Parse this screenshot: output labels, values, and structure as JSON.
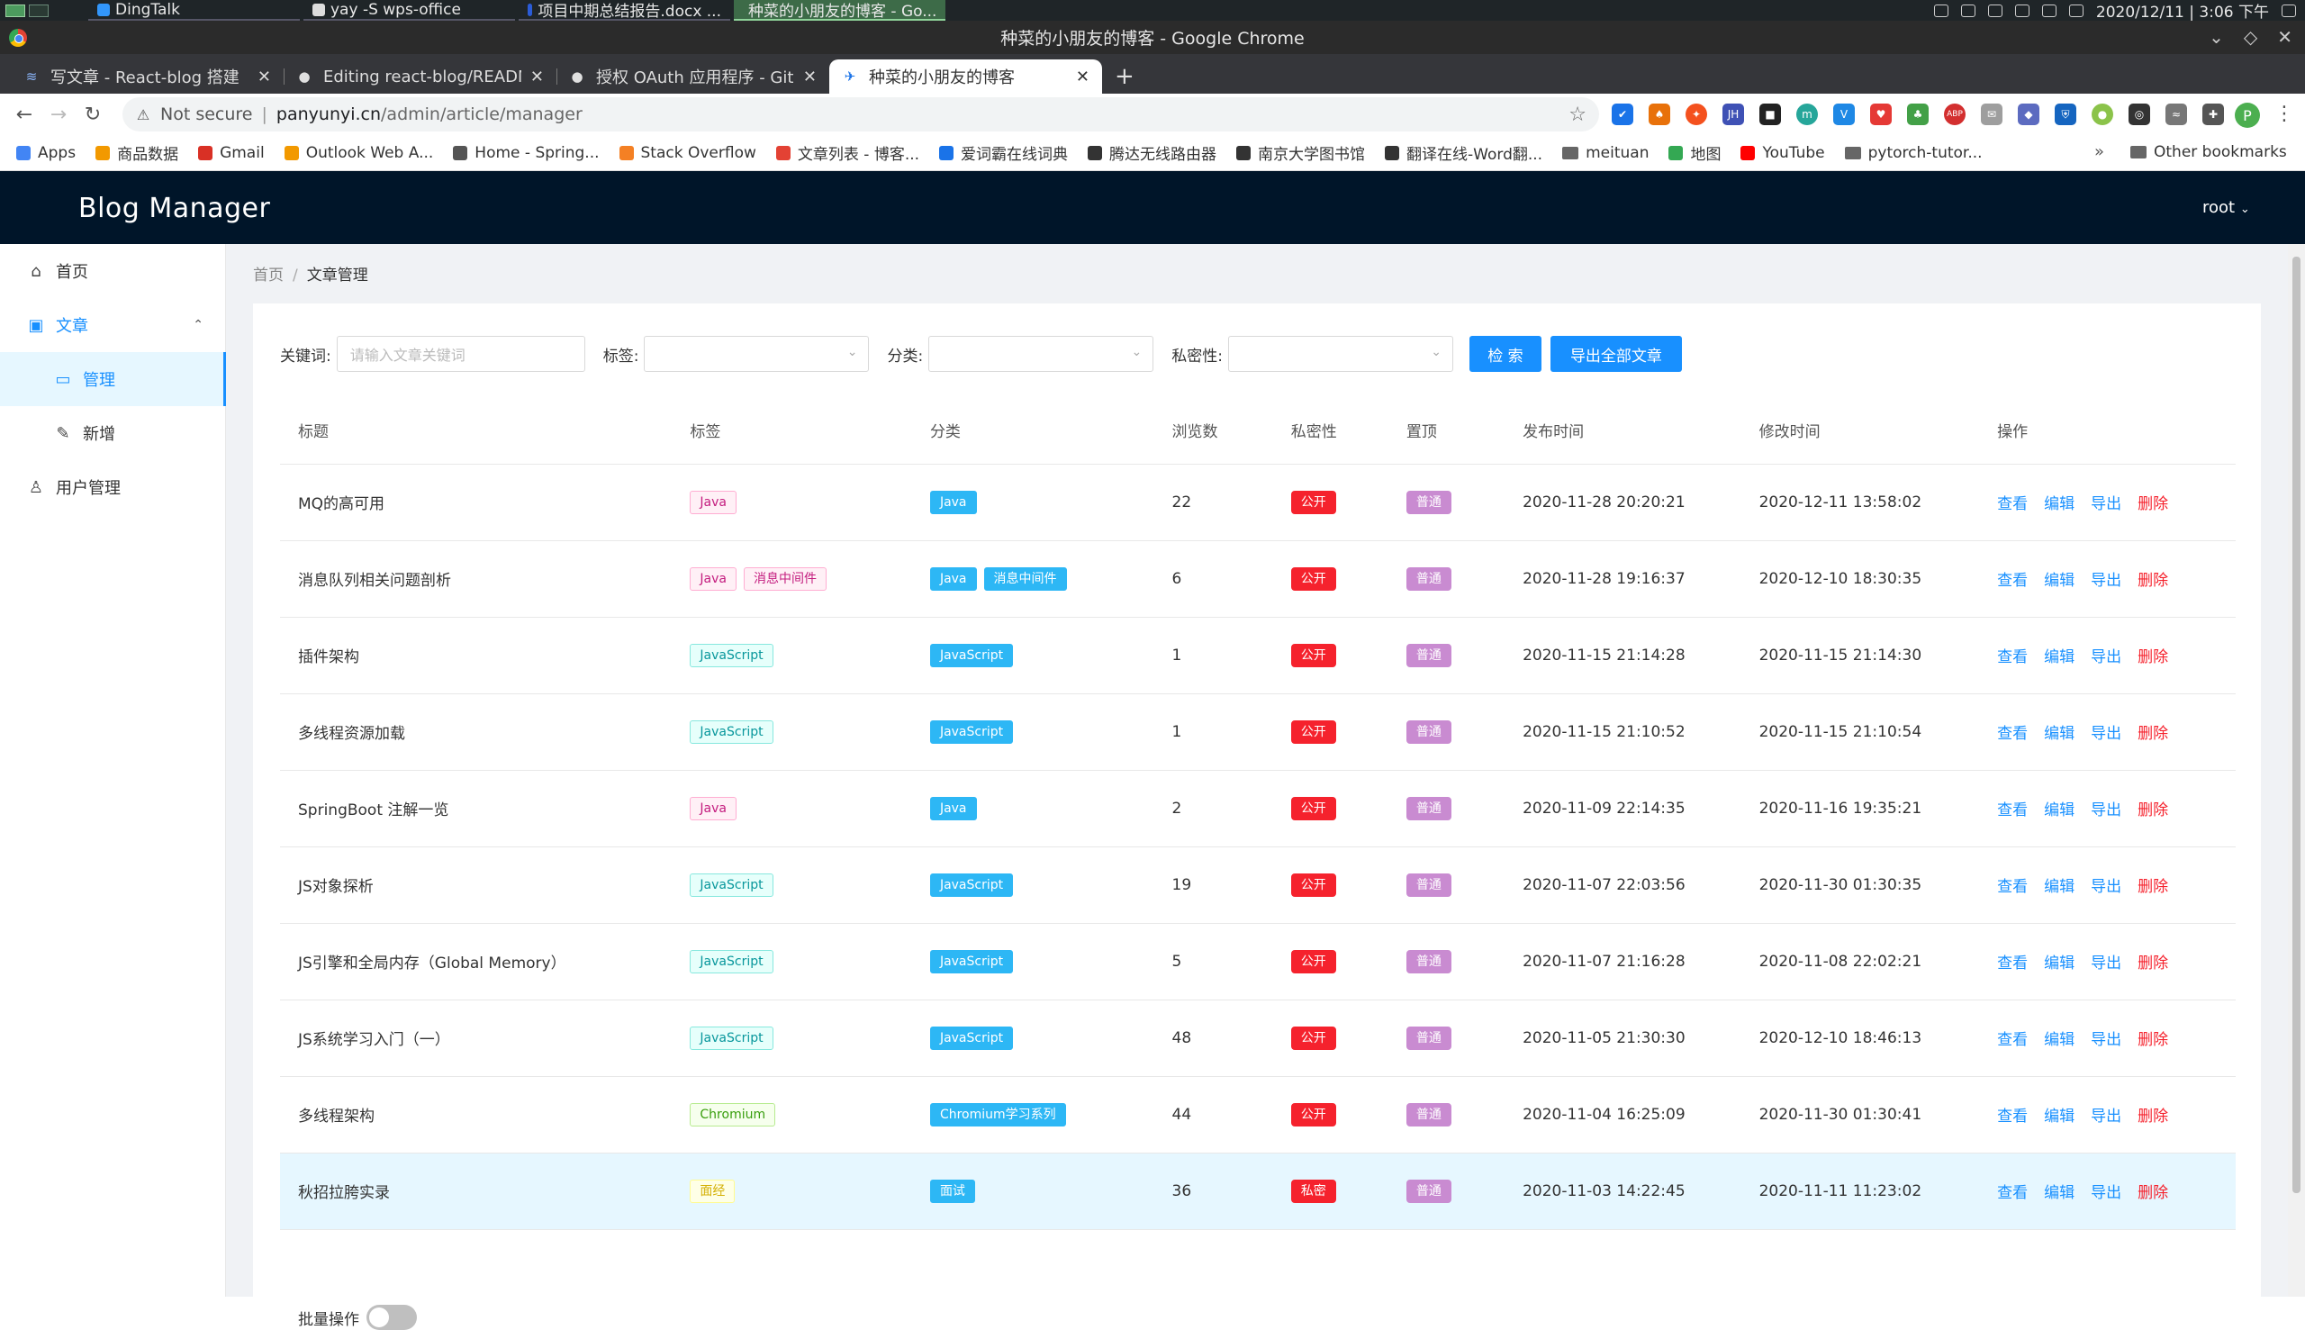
{
  "taskbar": {
    "tasks": [
      {
        "label": "DingTalk",
        "color": "#3296fa",
        "active": false
      },
      {
        "label": "yay -S wps-office",
        "color": "#dddddd",
        "active": false
      },
      {
        "label": "项目中期总结报告.docx ...",
        "color": "#2b5cd7",
        "active": false
      },
      {
        "label": "种菜的小朋友的博客 - Go...",
        "color": "#e34234",
        "active": true
      }
    ],
    "datetime": "2020/12/11 | 3:06 下午"
  },
  "window": {
    "title": "种菜的小朋友的博客 - Google Chrome"
  },
  "tabs": [
    {
      "label": "写文章 - React-blog 搭建",
      "icon": "zhihu-icon"
    },
    {
      "label": "Editing react-blog/README",
      "icon": "github-icon"
    },
    {
      "label": "授权 OAuth 应用程序 - GitHub",
      "icon": "github-icon"
    },
    {
      "label": "种菜的小朋友的博客",
      "icon": "bird-icon"
    }
  ],
  "address": {
    "security": "Not secure",
    "host": "panyunyi.cn",
    "path": "/admin/article/manager"
  },
  "bookmarks": [
    {
      "label": "Apps",
      "color": "#4285f4"
    },
    {
      "label": "商品数据",
      "color": "#f29900"
    },
    {
      "label": "Gmail",
      "color": "#d93025"
    },
    {
      "label": "Outlook Web A...",
      "color": "#f29900"
    },
    {
      "label": "Home - Spring...",
      "color": "#555555"
    },
    {
      "label": "Stack Overflow",
      "color": "#f48024"
    },
    {
      "label": "文章列表 - 博客...",
      "color": "#e34234"
    },
    {
      "label": "爱词霸在线词典",
      "color": "#1a73e8"
    },
    {
      "label": "腾达无线路由器",
      "color": "#333333"
    },
    {
      "label": "南京大学图书馆",
      "color": "#333333"
    },
    {
      "label": "翻译在线-Word翻...",
      "color": "#333333"
    },
    {
      "label": "meituan",
      "color": "#666666"
    },
    {
      "label": "地图",
      "color": "#34a853"
    },
    {
      "label": "YouTube",
      "color": "#ff0000"
    },
    {
      "label": "pytorch-tutor...",
      "color": "#666666"
    }
  ],
  "bookmarks_more": "»",
  "bookmarks_other": "Other bookmarks",
  "app": {
    "brand": "Blog Manager",
    "user": "root"
  },
  "sidebar": {
    "home": "首页",
    "article": "文章",
    "manage": "管理",
    "add": "新增",
    "users": "用户管理"
  },
  "breadcrumb": {
    "home": "首页",
    "current": "文章管理"
  },
  "filters": {
    "keyword_label": "关键词:",
    "keyword_placeholder": "请输入文章关键词",
    "tag_label": "标签:",
    "category_label": "分类:",
    "privacy_label": "私密性:",
    "search_button": "检 索",
    "export_all_button": "导出全部文章"
  },
  "table": {
    "headers": [
      "标题",
      "标签",
      "分类",
      "浏览数",
      "私密性",
      "置顶",
      "发布时间",
      "修改时间",
      "操作"
    ],
    "actions": {
      "view": "查看",
      "edit": "编辑",
      "export": "导出",
      "delete": "删除"
    },
    "rows": [
      {
        "title": "MQ的高可用",
        "tags": [
          {
            "t": "Java",
            "c": "java"
          }
        ],
        "cats": [
          "Java"
        ],
        "views": "22",
        "privacy": "公开",
        "pin": "普通",
        "published": "2020-11-28 20:20:21",
        "modified": "2020-12-11 13:58:02"
      },
      {
        "title": "消息队列相关问题剖析",
        "tags": [
          {
            "t": "Java",
            "c": "java"
          },
          {
            "t": "消息中间件",
            "c": "mq"
          }
        ],
        "cats": [
          "Java",
          "消息中间件"
        ],
        "views": "6",
        "privacy": "公开",
        "pin": "普通",
        "published": "2020-11-28 19:16:37",
        "modified": "2020-12-10 18:30:35"
      },
      {
        "title": "插件架构",
        "tags": [
          {
            "t": "JavaScript",
            "c": "js"
          }
        ],
        "cats": [
          "JavaScript"
        ],
        "views": "1",
        "privacy": "公开",
        "pin": "普通",
        "published": "2020-11-15 21:14:28",
        "modified": "2020-11-15 21:14:30"
      },
      {
        "title": "多线程资源加载",
        "tags": [
          {
            "t": "JavaScript",
            "c": "js"
          }
        ],
        "cats": [
          "JavaScript"
        ],
        "views": "1",
        "privacy": "公开",
        "pin": "普通",
        "published": "2020-11-15 21:10:52",
        "modified": "2020-11-15 21:10:54"
      },
      {
        "title": "SpringBoot 注解一览",
        "tags": [
          {
            "t": "Java",
            "c": "java"
          }
        ],
        "cats": [
          "Java"
        ],
        "views": "2",
        "privacy": "公开",
        "pin": "普通",
        "published": "2020-11-09 22:14:35",
        "modified": "2020-11-16 19:35:21"
      },
      {
        "title": "JS对象探析",
        "tags": [
          {
            "t": "JavaScript",
            "c": "js"
          }
        ],
        "cats": [
          "JavaScript"
        ],
        "views": "19",
        "privacy": "公开",
        "pin": "普通",
        "published": "2020-11-07 22:03:56",
        "modified": "2020-11-30 01:30:35"
      },
      {
        "title": "JS引擎和全局内存（Global Memory）",
        "tags": [
          {
            "t": "JavaScript",
            "c": "js"
          }
        ],
        "cats": [
          "JavaScript"
        ],
        "views": "5",
        "privacy": "公开",
        "pin": "普通",
        "published": "2020-11-07 21:16:28",
        "modified": "2020-11-08 22:02:21"
      },
      {
        "title": "JS系统学习入门（一）",
        "tags": [
          {
            "t": "JavaScript",
            "c": "js"
          }
        ],
        "cats": [
          "JavaScript"
        ],
        "views": "48",
        "privacy": "公开",
        "pin": "普通",
        "published": "2020-11-05 21:30:30",
        "modified": "2020-12-10 18:46:13"
      },
      {
        "title": "多线程架构",
        "tags": [
          {
            "t": "Chromium",
            "c": "chr"
          }
        ],
        "cats": [
          "Chromium学习系列"
        ],
        "views": "44",
        "privacy": "公开",
        "pin": "普通",
        "published": "2020-11-04 16:25:09",
        "modified": "2020-11-30 01:30:41"
      },
      {
        "title": "秋招拉胯实录",
        "tags": [
          {
            "t": "面经",
            "c": "ms"
          }
        ],
        "cats": [
          "面试"
        ],
        "views": "36",
        "privacy": "私密",
        "pin": "普通",
        "published": "2020-11-03 14:22:45",
        "modified": "2020-11-11 11:23:02",
        "highlight": true
      }
    ]
  },
  "batch_label": "批量操作"
}
